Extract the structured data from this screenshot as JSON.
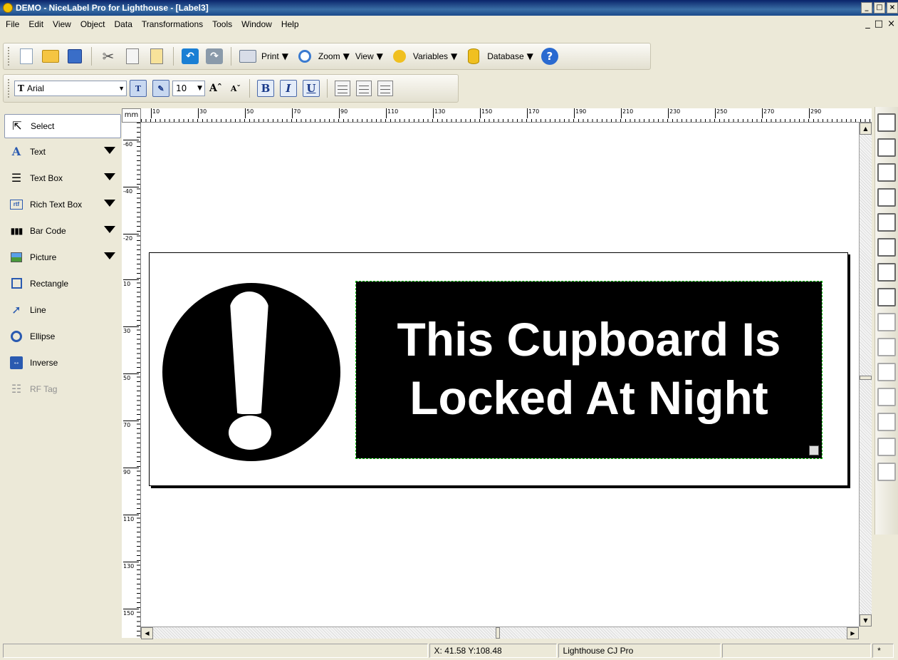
{
  "window": {
    "title": "DEMO - NiceLabel Pro for Lighthouse - [Label3]",
    "buttons": [
      "_",
      "□",
      "×"
    ],
    "mdi_buttons": [
      "_",
      "□",
      "×"
    ]
  },
  "menu": [
    "File",
    "Edit",
    "View",
    "Object",
    "Data",
    "Transformations",
    "Tools",
    "Window",
    "Help"
  ],
  "toolbar1": {
    "print": "Print",
    "zoom": "Zoom",
    "view": "View",
    "variables": "Variables",
    "database": "Database"
  },
  "toolbar2": {
    "font": "Arial",
    "size": "10",
    "bold": "B",
    "italic": "I",
    "underline": "U",
    "grow": "Aˆ",
    "shrink": "Aˇ"
  },
  "toolbox": [
    {
      "label": "Select",
      "icon": "pointer-icon"
    },
    {
      "label": "Text",
      "icon": "text-icon"
    },
    {
      "label": "Text Box",
      "icon": "text-box-icon"
    },
    {
      "label": "Rich Text Box",
      "icon": "rich-text-box-icon"
    },
    {
      "label": "Bar Code",
      "icon": "barcode-icon"
    },
    {
      "label": "Picture",
      "icon": "picture-icon"
    },
    {
      "label": "Rectangle",
      "icon": "rectangle-icon"
    },
    {
      "label": "Line",
      "icon": "line-icon"
    },
    {
      "label": "Ellipse",
      "icon": "ellipse-icon"
    },
    {
      "label": "Inverse",
      "icon": "inverse-icon"
    },
    {
      "label": "RF Tag",
      "icon": "rf-tag-icon"
    }
  ],
  "ruler": {
    "unit": "mm",
    "horizontal": [
      "10",
      "30",
      "50",
      "70",
      "90",
      "110",
      "130",
      "150",
      "170",
      "190",
      "210",
      "230",
      "250",
      "270",
      "290"
    ],
    "vertical": [
      "-60",
      "-40",
      "-20",
      "10",
      "30",
      "50",
      "70",
      "90",
      "110",
      "130",
      "150"
    ]
  },
  "label": {
    "line1": "This Cupboard Is",
    "line2": "Locked At Night"
  },
  "status": {
    "coords": "X: 41.58 Y:108.48",
    "printer": "Lighthouse CJ Pro",
    "extra": "*"
  }
}
